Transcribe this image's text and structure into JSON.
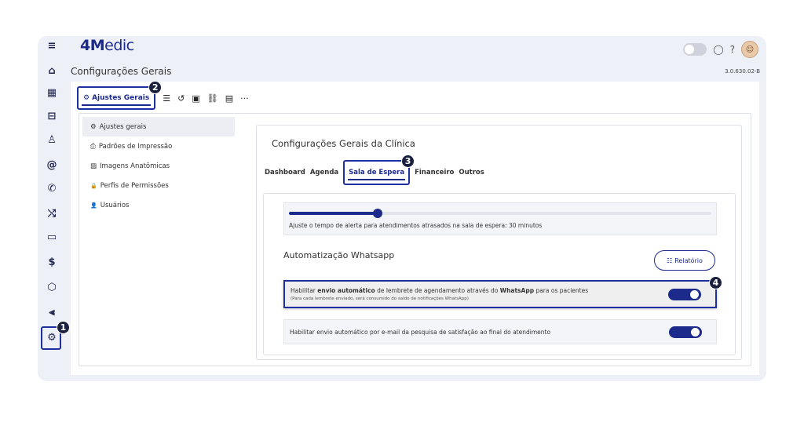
{
  "app": {
    "logo_brand": "4M",
    "logo_rest": "edic",
    "version": "3.0.630.02-B"
  },
  "header": {
    "page_title": "Configurações Gerais"
  },
  "rail": {
    "icons": [
      "menu-icon",
      "home-icon",
      "calendar-icon",
      "car-icon",
      "user-icon",
      "at-icon",
      "phone-icon",
      "shuffle-icon",
      "clipboard-icon",
      "dollar-icon",
      "box-icon",
      "chart-icon",
      "gear-icon"
    ],
    "glyphs": [
      "≡",
      "⌂",
      "▦",
      "⊟",
      "♙",
      "@",
      "✆",
      "⤭",
      "▭",
      "$",
      "⬡",
      "⫷",
      "⚙"
    ]
  },
  "badges": {
    "one": "1",
    "two": "2",
    "three": "3",
    "four": "4"
  },
  "toolbar": {
    "main_tab_icon": "⚙",
    "main_tab": "Ajustes Gerais",
    "icons": [
      "☰",
      "↺",
      "▣",
      "⛓",
      "▤",
      "···"
    ]
  },
  "menu": {
    "items": [
      {
        "icon": "⚙",
        "label": "Ajustes gerais"
      },
      {
        "icon": "⎙",
        "label": "Padrões de Impressão"
      },
      {
        "icon": "▨",
        "label": "Imagens Anatômicas"
      },
      {
        "icon": "🔒",
        "label": "Perfis de Permissões"
      },
      {
        "icon": "👤",
        "label": "Usuários"
      }
    ]
  },
  "card": {
    "title": "Configurações Gerais da Clínica",
    "tabs": [
      "Dashboard",
      "Agenda",
      "Sala de Espera",
      "Financeiro",
      "Outros"
    ]
  },
  "slider": {
    "value_fraction": 0.21,
    "label": "Ajuste o tempo de alerta para atendimentos atrasados na sala de espera: 30 minutos"
  },
  "whatsapp": {
    "title": "Automatização Whatsapp",
    "report_button_icon": "☷",
    "report_button": "Relatório",
    "row1": {
      "text_a": "Habilitar ",
      "text_b": "envio automático",
      "text_c": " de lembrete de agendamento através do ",
      "text_d": "WhatsApp",
      "text_e": " para os pacientes",
      "sub": "(Para cada lembrete enviado, será consumido do saldo de notificações WhatsApp)"
    },
    "row2": {
      "text": "Habilitar envio automático por e-mail da pesquisa de satisfação ao final do atendimento"
    }
  },
  "colors": {
    "accent": "#1c2a8c",
    "highlight": "#1e2fa0",
    "badge": "#1a1f3d"
  }
}
